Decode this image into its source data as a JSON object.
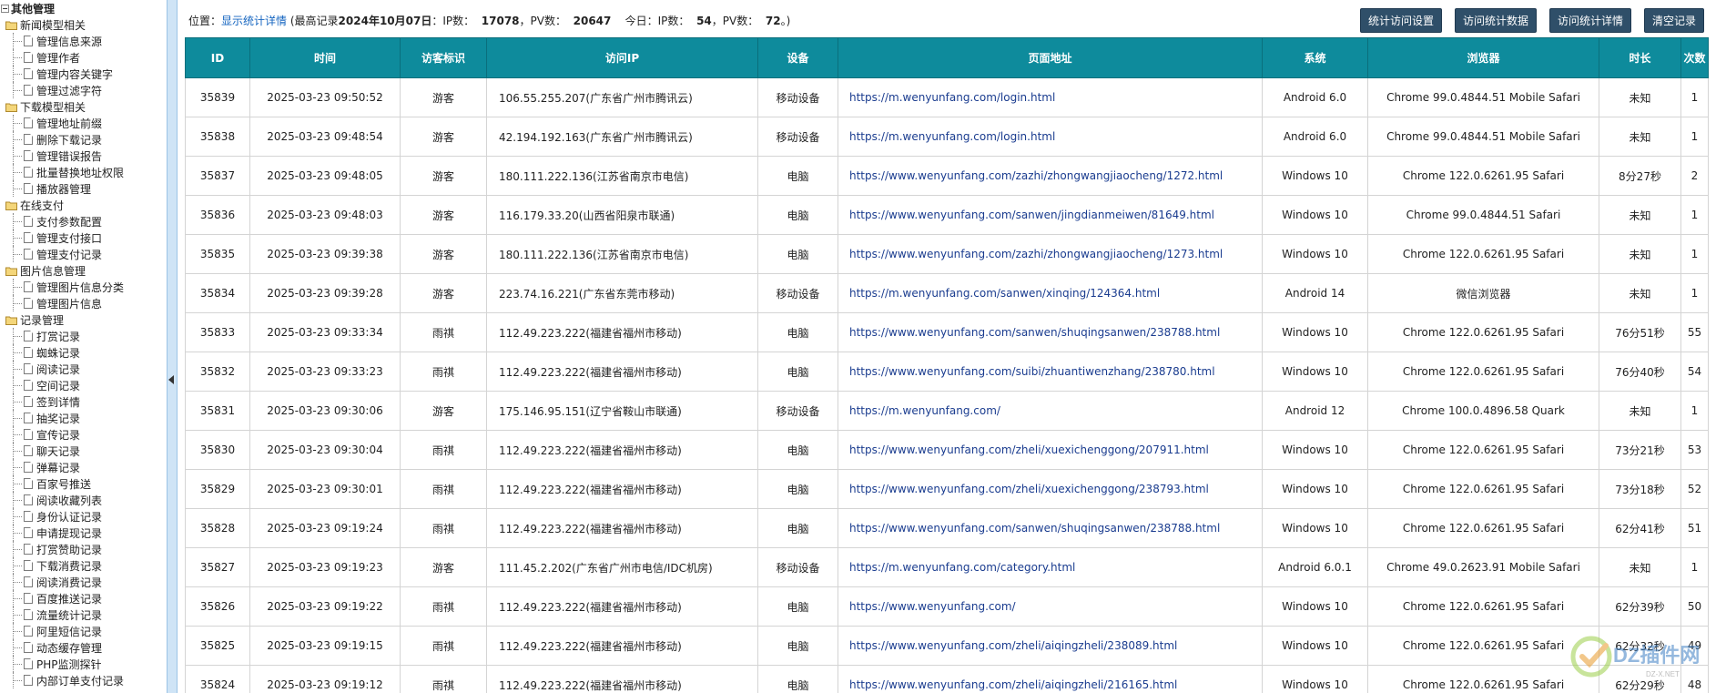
{
  "tree": {
    "root": "其他管理",
    "groups": [
      {
        "label": "新闻模型相关",
        "items": [
          "管理信息来源",
          "管理作者",
          "管理内容关键字",
          "管理过滤字符"
        ]
      },
      {
        "label": "下载模型相关",
        "items": [
          "管理地址前缀",
          "删除下载记录",
          "管理错误报告",
          "批量替换地址权限",
          "播放器管理"
        ]
      },
      {
        "label": "在线支付",
        "items": [
          "支付参数配置",
          "管理支付接口",
          "管理支付记录"
        ]
      },
      {
        "label": "图片信息管理",
        "items": [
          "管理图片信息分类",
          "管理图片信息"
        ]
      },
      {
        "label": "记录管理",
        "items": [
          "打赏记录",
          "蜘蛛记录",
          "阅读记录",
          "空间记录",
          "签到详情",
          "抽奖记录",
          "宣传记录",
          "聊天记录",
          "弹幕记录",
          "百家号推送",
          "阅读收藏列表",
          "身份认证记录",
          "申请提现记录",
          "打赏赞助记录",
          "下载消费记录",
          "阅读消费记录",
          "百度推送记录",
          "流量统计记录",
          "阿里短信记录",
          "动态缓存管理",
          "PHP监测探针",
          "内部订单支付记录"
        ]
      }
    ]
  },
  "location": {
    "prefix": "位置：",
    "link": "显示统计详情",
    "record_label": "(最高记录",
    "record_date": "2024年10月07日",
    "ip_label": "：IP数：",
    "ip_value": "17078",
    "pv_label": "，PV数：",
    "pv_value": "20647",
    "today_label": "今日：IP数：",
    "today_ip": "54",
    "today_pv_label": "，PV数：",
    "today_pv": "72",
    "suffix": "。)"
  },
  "toolbar": {
    "btn_settings": "统计访问设置",
    "btn_data": "访问统计数据",
    "btn_details": "访问统计详情",
    "btn_clear": "清空记录"
  },
  "table": {
    "headers": [
      "ID",
      "时间",
      "访客标识",
      "访问IP",
      "设备",
      "页面地址",
      "系统",
      "浏览器",
      "时长",
      "次数"
    ],
    "rows": [
      [
        "35839",
        "2025-03-23 09:50:52",
        "游客",
        "106.55.255.207(广东省广州市腾讯云)",
        "移动设备",
        "https://m.wenyunfang.com/login.html",
        "Android 6.0",
        "Chrome 99.0.4844.51 Mobile Safari",
        "未知",
        "1"
      ],
      [
        "35838",
        "2025-03-23 09:48:54",
        "游客",
        "42.194.192.163(广东省广州市腾讯云)",
        "移动设备",
        "https://m.wenyunfang.com/login.html",
        "Android 6.0",
        "Chrome 99.0.4844.51 Mobile Safari",
        "未知",
        "1"
      ],
      [
        "35837",
        "2025-03-23 09:48:05",
        "游客",
        "180.111.222.136(江苏省南京市电信)",
        "电脑",
        "https://www.wenyunfang.com/zazhi/zhongwangjiaocheng/1272.html",
        "Windows 10",
        "Chrome 122.0.6261.95 Safari",
        "8分27秒",
        "2"
      ],
      [
        "35836",
        "2025-03-23 09:48:03",
        "游客",
        "116.179.33.20(山西省阳泉市联通)",
        "电脑",
        "https://www.wenyunfang.com/sanwen/jingdianmeiwen/81649.html",
        "Windows 10",
        "Chrome 99.0.4844.51 Safari",
        "未知",
        "1"
      ],
      [
        "35835",
        "2025-03-23 09:39:38",
        "游客",
        "180.111.222.136(江苏省南京市电信)",
        "电脑",
        "https://www.wenyunfang.com/zazhi/zhongwangjiaocheng/1273.html",
        "Windows 10",
        "Chrome 122.0.6261.95 Safari",
        "未知",
        "1"
      ],
      [
        "35834",
        "2025-03-23 09:39:28",
        "游客",
        "223.74.16.221(广东省东莞市移动)",
        "移动设备",
        "https://m.wenyunfang.com/sanwen/xinqing/124364.html",
        "Android 14",
        "微信浏览器",
        "未知",
        "1"
      ],
      [
        "35833",
        "2025-03-23 09:33:34",
        "雨祺",
        "112.49.223.222(福建省福州市移动)",
        "电脑",
        "https://www.wenyunfang.com/sanwen/shuqingsanwen/238788.html",
        "Windows 10",
        "Chrome 122.0.6261.95 Safari",
        "76分51秒",
        "55"
      ],
      [
        "35832",
        "2025-03-23 09:33:23",
        "雨祺",
        "112.49.223.222(福建省福州市移动)",
        "电脑",
        "https://www.wenyunfang.com/suibi/zhuantiwenzhang/238780.html",
        "Windows 10",
        "Chrome 122.0.6261.95 Safari",
        "76分40秒",
        "54"
      ],
      [
        "35831",
        "2025-03-23 09:30:06",
        "游客",
        "175.146.95.151(辽宁省鞍山市联通)",
        "移动设备",
        "https://m.wenyunfang.com/",
        "Android 12",
        "Chrome 100.0.4896.58 Quark",
        "未知",
        "1"
      ],
      [
        "35830",
        "2025-03-23 09:30:04",
        "雨祺",
        "112.49.223.222(福建省福州市移动)",
        "电脑",
        "https://www.wenyunfang.com/zheli/xuexichenggong/207911.html",
        "Windows 10",
        "Chrome 122.0.6261.95 Safari",
        "73分21秒",
        "53"
      ],
      [
        "35829",
        "2025-03-23 09:30:01",
        "雨祺",
        "112.49.223.222(福建省福州市移动)",
        "电脑",
        "https://www.wenyunfang.com/zheli/xuexichenggong/238793.html",
        "Windows 10",
        "Chrome 122.0.6261.95 Safari",
        "73分18秒",
        "52"
      ],
      [
        "35828",
        "2025-03-23 09:19:24",
        "雨祺",
        "112.49.223.222(福建省福州市移动)",
        "电脑",
        "https://www.wenyunfang.com/sanwen/shuqingsanwen/238788.html",
        "Windows 10",
        "Chrome 122.0.6261.95 Safari",
        "62分41秒",
        "51"
      ],
      [
        "35827",
        "2025-03-23 09:19:23",
        "游客",
        "111.45.2.202(广东省广州市电信/IDC机房)",
        "移动设备",
        "https://m.wenyunfang.com/category.html",
        "Android 6.0.1",
        "Chrome 49.0.2623.91 Mobile Safari",
        "未知",
        "1"
      ],
      [
        "35826",
        "2025-03-23 09:19:22",
        "雨祺",
        "112.49.223.222(福建省福州市移动)",
        "电脑",
        "https://www.wenyunfang.com/",
        "Windows 10",
        "Chrome 122.0.6261.95 Safari",
        "62分39秒",
        "50"
      ],
      [
        "35825",
        "2025-03-23 09:19:15",
        "雨祺",
        "112.49.223.222(福建省福州市移动)",
        "电脑",
        "https://www.wenyunfang.com/zheli/aiqingzheli/238089.html",
        "Windows 10",
        "Chrome 122.0.6261.95 Safari",
        "62分32秒",
        "49"
      ],
      [
        "35824",
        "2025-03-23 09:19:12",
        "雨祺",
        "112.49.223.222(福建省福州市移动)",
        "电脑",
        "https://www.wenyunfang.com/zheli/aiqingzheli/216165.html",
        "Windows 10",
        "Chrome 122.0.6261.95 Safari",
        "62分29秒",
        "48"
      ]
    ]
  },
  "watermark": {
    "text": "DZ插件网",
    "sub": "DZ-X.NET"
  },
  "icons": {
    "folder": "folder-icon",
    "page": "page-icon",
    "collapse": "collapse-arrow-icon",
    "watermark_logo": "check-logo-icon"
  },
  "colors": {
    "header_bg": "#0e8b9c",
    "button_bg": "#2f4f69",
    "link": "#1a3c8f",
    "splitter": "#cfe4f6"
  }
}
